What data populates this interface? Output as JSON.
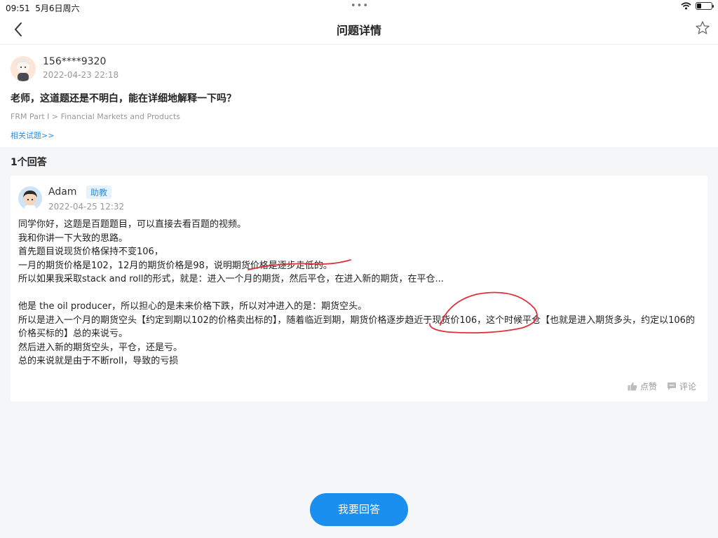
{
  "status_bar": {
    "time": "09:51",
    "date": "5月6日周六",
    "battery_level": 0.3
  },
  "nav": {
    "title": "问题详情",
    "back_icon": "chevron-left-icon",
    "star_icon": "star-outline-icon"
  },
  "question": {
    "user": "156****9320",
    "time": "2022-04-23 22:18",
    "text": "老师，这道题还是不明白，能在详细地解释一下吗？",
    "breadcrumb": "FRM Part I > Financial Markets and Products",
    "related_link": "相关试题>>"
  },
  "answer_count": "1个回答",
  "answer": {
    "user": "Adam",
    "badge": "助教",
    "time": "2022-04-25 12:32",
    "lines": [
      "同学你好，这题是百题题目，可以直接去看百题的视频。",
      "我和你讲一下大致的思路。",
      "首先题目说现货价格保持不变106，",
      "一月的期货价格是102，12月的期货价格是98，说明期货价格是逐步走低的。",
      "所以如果我采取stack and roll的形式，就是：进入一个月的期货，然后平仓，在进入新的期货，在平仓...",
      "",
      "他是 the oil producer，所以担心的是未来价格下跌，所以对冲进入的是：期货空头。",
      "所以是进入一个月的期货空头【约定到期以102的价格卖出标的】，随着临近到期，期货价格逐步趋近于现货价106，这个时候平仓【也就是进入期货多头，约定以106的价格买标的】总的来说亏。",
      "然后进入新的期货空头，平仓，还是亏。",
      "总的来说就是由于不断roll，导致的亏损"
    ],
    "like_label": "点赞",
    "comment_label": "评论"
  },
  "reply_button": "我要回答",
  "colors": {
    "accent": "#1a8ff0",
    "ink": "#e0303a"
  }
}
